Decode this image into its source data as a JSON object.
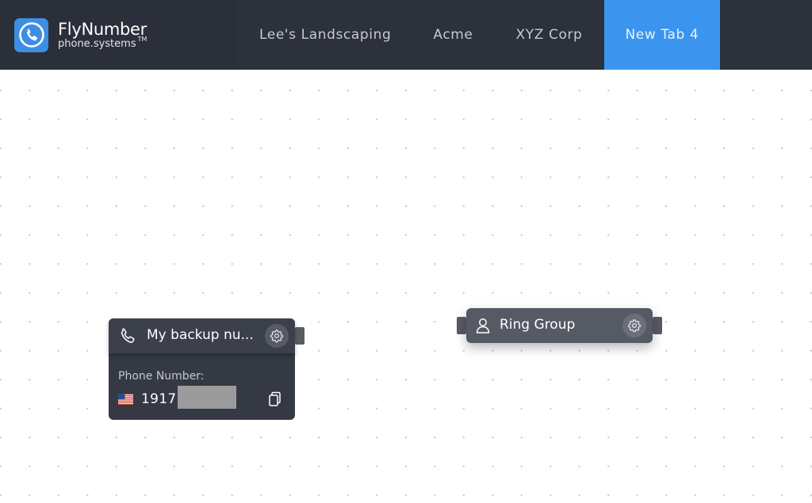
{
  "brand": {
    "name": "FlyNumber",
    "sub": "phone.systems",
    "tm": "TM",
    "logo_icon": "phone-icon"
  },
  "tabs": [
    {
      "label": "Lee's Landscaping",
      "active": false
    },
    {
      "label": "Acme",
      "active": false
    },
    {
      "label": "XYZ Corp",
      "active": false
    },
    {
      "label": "New Tab 4",
      "active": true
    }
  ],
  "colors": {
    "header_bg": "#2c313c",
    "active_tab": "#3b95ef",
    "logo_bg": "#3d8fe3",
    "node_dark": "#343944",
    "node_gray": "#555a65"
  },
  "nodes": {
    "backup_number": {
      "title": "My backup nu...",
      "icon": "phone-icon",
      "field_label": "Phone Number:",
      "country_flag": "us-flag-icon",
      "phone_number": "19177"
    },
    "ring_group": {
      "title": "Ring Group",
      "icon": "user-icon"
    }
  }
}
